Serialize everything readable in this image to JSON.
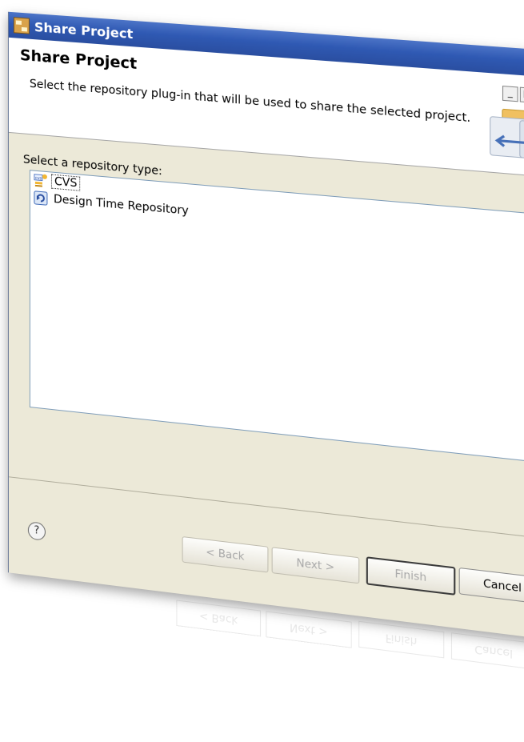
{
  "window": {
    "title": "Share Project"
  },
  "banner": {
    "title": "Share Project",
    "description": "Select the repository plug-in that will be used to share the selected project.",
    "controls": {
      "minimize": "_",
      "maximize": "□",
      "close": "x"
    }
  },
  "content": {
    "list_label": "Select a repository type:",
    "items": [
      {
        "label": "CVS",
        "selected": true
      },
      {
        "label": "Design Time Repository",
        "selected": false
      }
    ]
  },
  "footer": {
    "help_label": "?",
    "back_label": "< Back",
    "next_label": "Next >",
    "finish_label": "Finish",
    "cancel_label": "Cancel"
  },
  "colors": {
    "titlebar": "#2f59b3",
    "dialog_bg": "#ece9d8",
    "list_border": "#7f9db9",
    "disabled_text": "#a8a8a8"
  },
  "icons": {
    "app": "share-project-icon",
    "cvs": "cvs-icon",
    "dtr": "design-time-repository-icon",
    "banner": "folder-share-icon",
    "help": "help-icon"
  }
}
